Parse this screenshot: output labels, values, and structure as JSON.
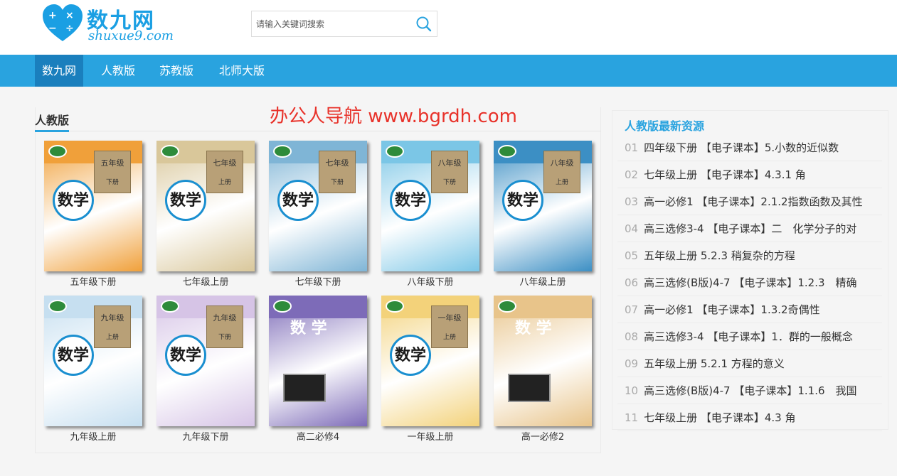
{
  "header": {
    "logo_text": "数九网",
    "logo_sub": "shuxue9.com",
    "search_placeholder": "请输入关键词搜索"
  },
  "nav": [
    {
      "label": "数九网",
      "active": true
    },
    {
      "label": "人教版",
      "active": false
    },
    {
      "label": "苏教版",
      "active": false
    },
    {
      "label": "北师大版",
      "active": false
    }
  ],
  "watermark": "办公人导航  www.bgrdh.com",
  "section": {
    "title": "人教版"
  },
  "books": [
    {
      "label": "五年级下册",
      "cover_text": "数学",
      "grade": "五年级",
      "term": "下册",
      "color": "#f0a03a"
    },
    {
      "label": "七年级上册",
      "cover_text": "数学",
      "grade": "七年级",
      "term": "上册",
      "color": "#d9c79a"
    },
    {
      "label": "七年级下册",
      "cover_text": "数学",
      "grade": "七年级",
      "term": "下册",
      "color": "#7fb5d6"
    },
    {
      "label": "八年级下册",
      "cover_text": "数学",
      "grade": "八年级",
      "term": "下册",
      "color": "#7bc6e6"
    },
    {
      "label": "八年级上册",
      "cover_text": "数学",
      "grade": "八年级",
      "term": "上册",
      "color": "#3c8fc4"
    },
    {
      "label": "九年级上册",
      "cover_text": "数学",
      "grade": "九年级",
      "term": "上册",
      "color": "#c6dff0"
    },
    {
      "label": "九年级下册",
      "cover_text": "数学",
      "grade": "九年级",
      "term": "下册",
      "color": "#d6c4e6"
    },
    {
      "label": "高二必修4",
      "cover_text": "数 学",
      "grade": "",
      "term": "",
      "color": "#7d6bb8"
    },
    {
      "label": "一年级上册",
      "cover_text": "数学",
      "grade": "一年级",
      "term": "上册",
      "color": "#f3d27a"
    },
    {
      "label": "高一必修2",
      "cover_text": "数 学",
      "grade": "",
      "term": "",
      "color": "#e8c48a"
    }
  ],
  "sidebar": {
    "title": "人教版最新资源",
    "items": [
      {
        "num": "01",
        "text": "四年级下册 【电子课本】5.小数的近似数"
      },
      {
        "num": "02",
        "text": "七年级上册 【电子课本】4.3.1 角"
      },
      {
        "num": "03",
        "text": "高一必修1 【电子课本】2.1.2指数函数及其性"
      },
      {
        "num": "04",
        "text": "高三选修3-4 【电子课本】二　化学分子的对"
      },
      {
        "num": "05",
        "text": "五年级上册 5.2.3 稍复杂的方程"
      },
      {
        "num": "06",
        "text": "高三选修(B版)4-7 【电子课本】1.2.3　精确"
      },
      {
        "num": "07",
        "text": "高一必修1 【电子课本】1.3.2奇偶性"
      },
      {
        "num": "08",
        "text": "高三选修3-4 【电子课本】1．群的一般概念"
      },
      {
        "num": "09",
        "text": "五年级上册 5.2.1 方程的意义"
      },
      {
        "num": "10",
        "text": "高三选修(B版)4-7 【电子课本】1.1.6　我国"
      },
      {
        "num": "11",
        "text": "七年级上册 【电子课本】4.3 角"
      }
    ]
  },
  "colors": {
    "accent": "#29a3df",
    "nav_active": "#1a7fbd",
    "watermark": "#e8322a"
  }
}
